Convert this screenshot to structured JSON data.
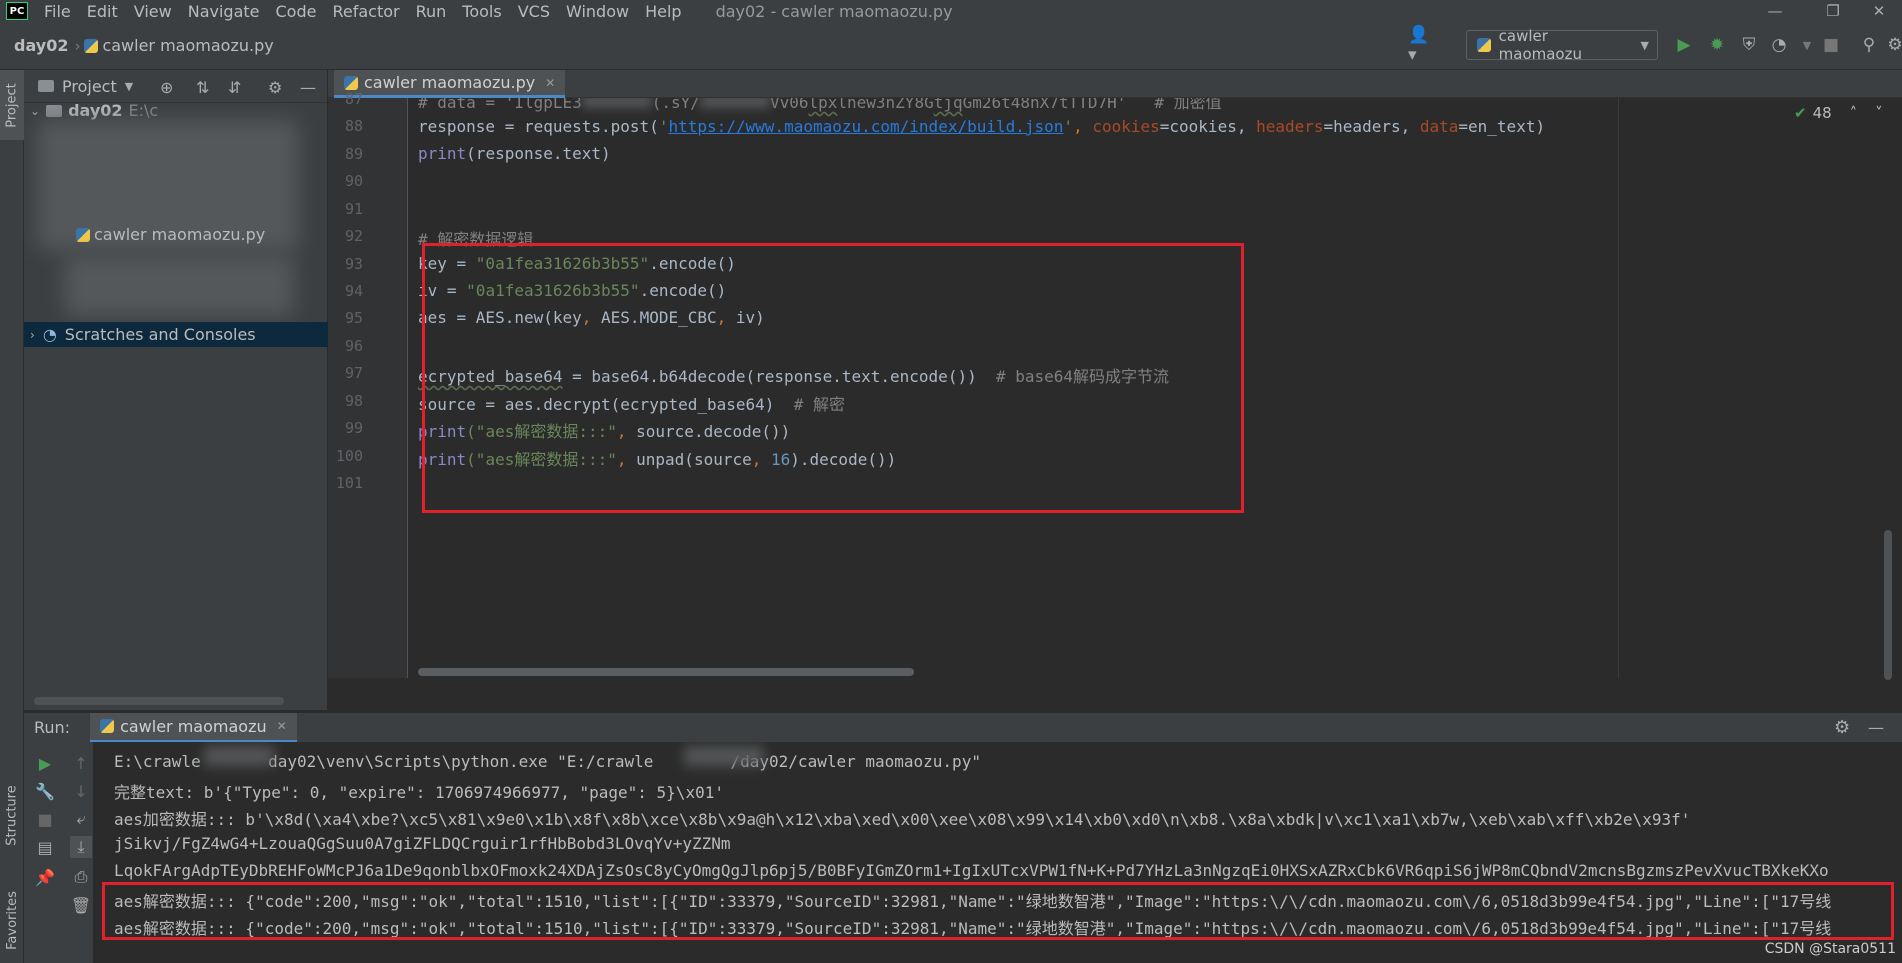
{
  "menubar": {
    "logo": "PC",
    "items": [
      "File",
      "Edit",
      "View",
      "Navigate",
      "Code",
      "Refactor",
      "Run",
      "Tools",
      "VCS",
      "Window",
      "Help"
    ],
    "window_title": "day02 - cawler maomaozu.py"
  },
  "navbar": {
    "project": "day02",
    "file": "cawler maomaozu.py",
    "run_config": "cawler maomaozu"
  },
  "left_strip": {
    "project": "Project",
    "structure": "Structure",
    "favorites": "Favorites"
  },
  "project_panel": {
    "title": "Project",
    "root": "day02",
    "root_path": "E:\\c",
    "file": "cawler maomaozu.py",
    "scratches": "Scratches and Consoles"
  },
  "editor": {
    "tab_label": "cawler maomaozu.py",
    "inspection_count": "48",
    "line_numbers": [
      "87",
      "88",
      "89",
      "90",
      "91",
      "92",
      "93",
      "94",
      "95",
      "96",
      "97",
      "98",
      "99",
      "100",
      "101"
    ],
    "l87": {
      "a": "# data = 'IlgpLE3",
      "b": "(.sY/",
      "c": "Vv06",
      "d": "lpx",
      "e": "lnew3nZY8G",
      "f": "tjq",
      "g": "Gm26t48nX7tTTD7H'",
      "h": "# 加密值"
    },
    "l88": {
      "a": "response = requests.post(",
      "url": "https://www.maomaozu.com/index/build.json",
      "sep": ", ",
      "p1": "cookies",
      "v1": "=cookies, ",
      "p2": "headers",
      "v2": "=headers, ",
      "p3": "data",
      "v3": "=en_text)"
    },
    "l89": {
      "fn": "print",
      "rest": "(response.text)"
    },
    "l92": "# 解密数据逻辑",
    "l93": {
      "a": "key = ",
      "s": "\"0a1fea31626b3b55\"",
      "b": ".encode()"
    },
    "l94": {
      "a": "iv = ",
      "s": "\"0a1fea31626b3b55\"",
      "b": ".encode()"
    },
    "l95": {
      "a": "aes = AES.new(key",
      "sep1": ", ",
      "b": "AES.MODE_CBC",
      "sep2": ", ",
      "c": "iv)"
    },
    "l97": {
      "a": "ecrypted_base64",
      "b": " = base64.b64decode(response.text.encode())  ",
      "c": "# base64解码成字节流"
    },
    "l98": {
      "a": "source = aes.decrypt(ecrypted_base64)  ",
      "c": "# 解密"
    },
    "l99": {
      "fn": "print",
      "s": "(\"aes解密数据:::\"",
      "sep": ", ",
      "rest": "source.decode())"
    },
    "l100": {
      "fn": "print",
      "s": "(\"aes解密数据:::\"",
      "sep": ", ",
      "a": "unpad(source",
      "sep2": ", ",
      "n": "16",
      "b": ").decode())"
    }
  },
  "run_panel": {
    "label": "Run:",
    "tab_label": "cawler maomaozu",
    "console": [
      "E:\\crawle       day02\\venv\\Scripts\\python.exe \"E:/crawle        /day02/cawler maomaozu.py\"",
      "完整text: b'{\"Type\": 0, \"expire\": 1706974966977, \"page\": 5}\\x01'",
      "aes加密数据::: b'\\x8d(\\xa4\\xbe?\\xc5\\x81\\x9e0\\x1b\\x8f\\x8b\\xce\\x8b\\x9a@h\\x12\\xba\\xed\\x00\\xee\\x08\\x99\\x14\\xb0\\xd0\\n\\xb8.\\x8a\\xbdk|v\\xc1\\xa1\\xb7w,\\xeb\\xab\\xff\\xb2e\\x93f'",
      "jSikvj/FgZ4wG4+LzouaQGgSuu0A7giZFLDQCrguir1rfHbBobd3LOvqYv+yZZNm",
      "LqokFArgAdpTEyDbREHFoWMcPJ6a1De9qonblbxOFmoxk24XDAjZsOsC8yCyOmgQgJlp6pj5/B0BFyIGmZOrm1+IgIxUTcxVPW1fN+K+Pd7YHzLa3nNgzqEi0HXSxAZRxCbk6VR6qpiS6jWP8mCQbndV2mcnsBgzmszPevXvucTBXkeKXo",
      "aes解密数据::: {\"code\":200,\"msg\":\"ok\",\"total\":1510,\"list\":[{\"ID\":33379,\"SourceID\":32981,\"Name\":\"绿地数智港\",\"Image\":\"https:\\/\\/cdn.maomaozu.com\\/6,0518d3b99e4f54.jpg\",\"Line\":[\"17号线",
      "aes解密数据::: {\"code\":200,\"msg\":\"ok\",\"total\":1510,\"list\":[{\"ID\":33379,\"SourceID\":32981,\"Name\":\"绿地数智港\",\"Image\":\"https:\\/\\/cdn.maomaozu.com\\/6,0518d3b99e4f54.jpg\",\"Line\":[\"17号线"
    ]
  },
  "watermark": "CSDN @Stara0511",
  "colors": {
    "accent": "#4a88c7",
    "highlight_box": "#e0202a",
    "run_green": "#499c54"
  }
}
